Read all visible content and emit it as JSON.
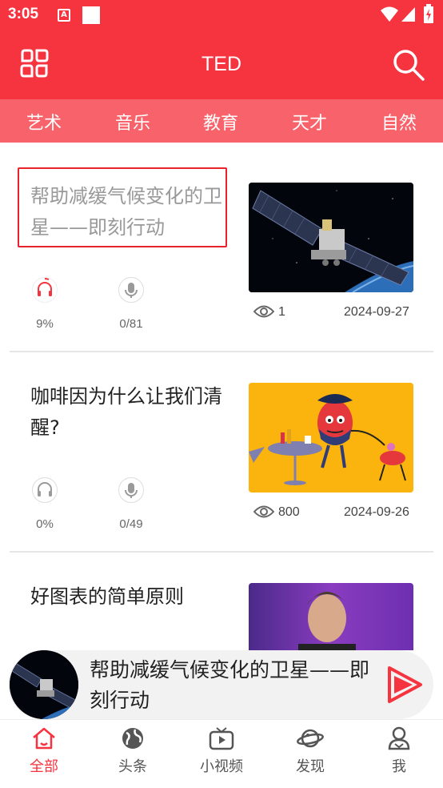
{
  "status": {
    "time": "3:05"
  },
  "header": {
    "title": "TED"
  },
  "categories": [
    "艺术",
    "音乐",
    "教育",
    "天才",
    "自然"
  ],
  "articles": [
    {
      "title": "帮助减缓气候变化的卫星——即刻行动",
      "listen_progress": "9%",
      "record_count": "0/81",
      "views": "1",
      "date": "2024-09-27",
      "highlighted": true
    },
    {
      "title": "咖啡因为什么让我们清醒?",
      "listen_progress": "0%",
      "record_count": "0/49",
      "views": "800",
      "date": "2024-09-26",
      "highlighted": false
    },
    {
      "title": "好图表的简单原则"
    }
  ],
  "player": {
    "title": "帮助减缓气候变化的卫星——即刻行动"
  },
  "tabs": [
    {
      "label": "全部",
      "icon": "home-icon",
      "active": true
    },
    {
      "label": "头条",
      "icon": "globe-icon",
      "active": false
    },
    {
      "label": "小视频",
      "icon": "tv-icon",
      "active": false
    },
    {
      "label": "发现",
      "icon": "planet-icon",
      "active": false
    },
    {
      "label": "我",
      "icon": "person-icon",
      "active": false
    }
  ],
  "colors": {
    "brand": "#f53440",
    "tabs_bg": "#f8636b",
    "highlight_box": "#e8232d"
  }
}
